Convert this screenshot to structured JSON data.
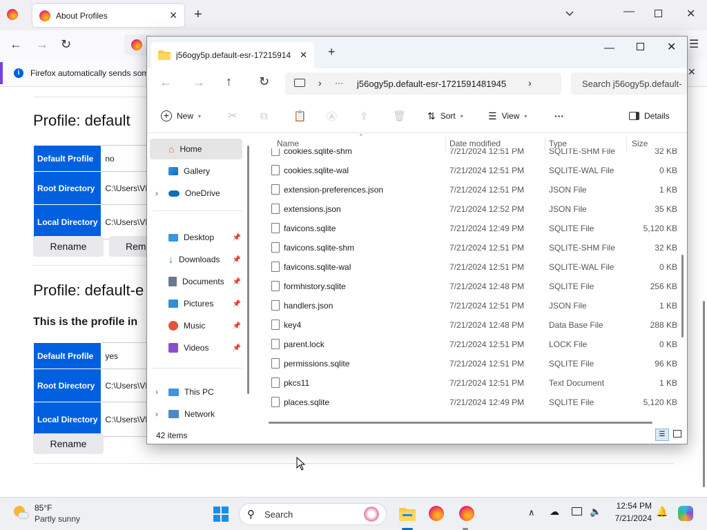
{
  "firefox": {
    "tab_title": "About Profiles",
    "notification": "Firefox automatically sends som",
    "profiles": [
      {
        "heading": "Profile: default",
        "rows": [
          {
            "key": "Default Profile",
            "value": "no"
          },
          {
            "key": "Root Directory",
            "value": "C:\\Users\\VM"
          },
          {
            "key": "Local Directory",
            "value": "C:\\Users\\VM"
          }
        ],
        "buttons": [
          "Rename",
          "Rem"
        ]
      },
      {
        "heading": "Profile: default-e",
        "subheading": "This is the profile in",
        "rows": [
          {
            "key": "Default Profile",
            "value": "yes"
          },
          {
            "key": "Root Directory",
            "value": "C:\\Users\\VM"
          },
          {
            "key": "Local Directory",
            "value": "C:\\Users\\VM"
          }
        ],
        "buttons": [
          "Rename"
        ]
      }
    ]
  },
  "explorer": {
    "tab_title": "j56ogy5p.default-esr-17215914",
    "address": "j56ogy5p.default-esr-1721591481945",
    "address_ellipsis": "···",
    "search_placeholder": "Search j56ogy5p.default-",
    "toolbar": {
      "new": "New",
      "sort": "Sort",
      "view": "View",
      "more": "···",
      "details": "Details"
    },
    "nav": {
      "home": "Home",
      "gallery": "Gallery",
      "onedrive": "OneDrive",
      "desktop": "Desktop",
      "downloads": "Downloads",
      "documents": "Documents",
      "pictures": "Pictures",
      "music": "Music",
      "videos": "Videos",
      "thispc": "This PC",
      "network": "Network"
    },
    "columns": {
      "name": "Name",
      "date": "Date modified",
      "type": "Type",
      "size": "Size"
    },
    "files": [
      {
        "name": "cookies.sqlite-shm",
        "date": "7/21/2024 12:51 PM",
        "type": "SQLITE-SHM File",
        "size": "32 KB"
      },
      {
        "name": "cookies.sqlite-wal",
        "date": "7/21/2024 12:51 PM",
        "type": "SQLITE-WAL File",
        "size": "0 KB"
      },
      {
        "name": "extension-preferences.json",
        "date": "7/21/2024 12:51 PM",
        "type": "JSON File",
        "size": "1 KB"
      },
      {
        "name": "extensions.json",
        "date": "7/21/2024 12:52 PM",
        "type": "JSON File",
        "size": "35 KB"
      },
      {
        "name": "favicons.sqlite",
        "date": "7/21/2024 12:49 PM",
        "type": "SQLITE File",
        "size": "5,120 KB"
      },
      {
        "name": "favicons.sqlite-shm",
        "date": "7/21/2024 12:51 PM",
        "type": "SQLITE-SHM File",
        "size": "32 KB"
      },
      {
        "name": "favicons.sqlite-wal",
        "date": "7/21/2024 12:51 PM",
        "type": "SQLITE-WAL File",
        "size": "0 KB"
      },
      {
        "name": "formhistory.sqlite",
        "date": "7/21/2024 12:48 PM",
        "type": "SQLITE File",
        "size": "256 KB"
      },
      {
        "name": "handlers.json",
        "date": "7/21/2024 12:51 PM",
        "type": "JSON File",
        "size": "1 KB"
      },
      {
        "name": "key4",
        "date": "7/21/2024 12:48 PM",
        "type": "Data Base File",
        "size": "288 KB"
      },
      {
        "name": "parent.lock",
        "date": "7/21/2024 12:51 PM",
        "type": "LOCK File",
        "size": "0 KB"
      },
      {
        "name": "permissions.sqlite",
        "date": "7/21/2024 12:51 PM",
        "type": "SQLITE File",
        "size": "96 KB"
      },
      {
        "name": "pkcs11",
        "date": "7/21/2024 12:51 PM",
        "type": "Text Document",
        "size": "1 KB"
      },
      {
        "name": "places.sqlite",
        "date": "7/21/2024 12:49 PM",
        "type": "SQLITE File",
        "size": "5,120 KB"
      }
    ],
    "status": "42 items"
  },
  "taskbar": {
    "weather_temp": "85°F",
    "weather_desc": "Partly sunny",
    "search": "Search",
    "time": "12:54 PM",
    "date": "7/21/2024"
  }
}
